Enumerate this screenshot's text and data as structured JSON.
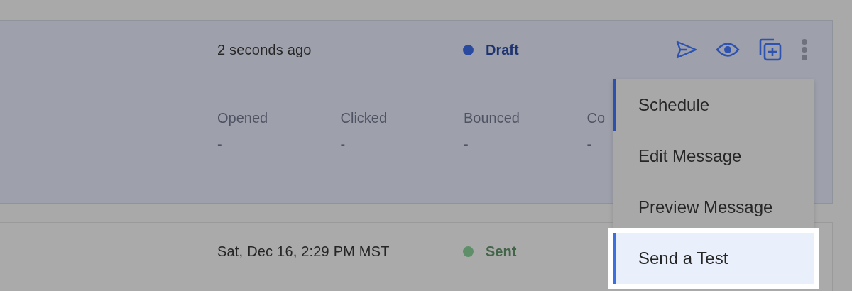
{
  "messages": [
    {
      "time": "2 seconds ago",
      "status": {
        "label": "Draft",
        "color": "#2a4aa0"
      },
      "stats": [
        {
          "label": "Opened",
          "value": "-"
        },
        {
          "label": "Clicked",
          "value": "-"
        },
        {
          "label": "Bounced",
          "value": "-"
        },
        {
          "label": "Co",
          "value": "-"
        }
      ],
      "actions": [
        {
          "kind": "send"
        },
        {
          "kind": "eye"
        },
        {
          "kind": "copy"
        },
        {
          "kind": "more"
        }
      ]
    },
    {
      "time": "Sat, Dec 16, 2:29 PM MST",
      "status": {
        "label": "Sent",
        "color": "#5e8f68"
      }
    }
  ],
  "menu": {
    "items": [
      {
        "label": "Schedule",
        "selected": false,
        "focused": true
      },
      {
        "label": "Edit Message",
        "selected": false,
        "focused": false
      },
      {
        "label": "Preview Message",
        "selected": false,
        "focused": false
      },
      {
        "label": "Send a Test",
        "selected": true,
        "focused": false
      }
    ]
  }
}
